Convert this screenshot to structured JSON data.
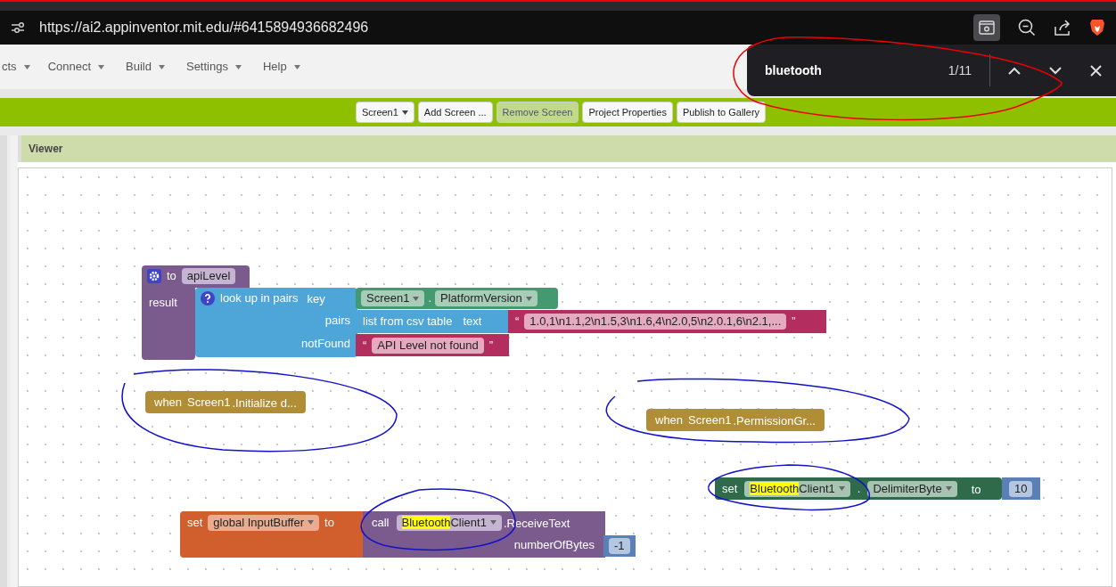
{
  "browser": {
    "url": "https://ai2.appinventor.mit.edu/#6415894936682496",
    "find_bar": {
      "query": "bluetooth",
      "count": "1/11"
    }
  },
  "menu": [
    "cts",
    "Connect",
    "Build",
    "Settings",
    "Help"
  ],
  "toolbar": [
    {
      "label": "Screen1",
      "dropdown": true,
      "disabled": false
    },
    {
      "label": "Add Screen ...",
      "dropdown": false,
      "disabled": false
    },
    {
      "label": "Remove Screen",
      "dropdown": false,
      "disabled": true
    },
    {
      "label": "Project Properties",
      "dropdown": false,
      "disabled": false
    },
    {
      "label": "Publish to Gallery",
      "dropdown": false,
      "disabled": false
    }
  ],
  "viewer": {
    "title": "Viewer",
    "procedure": {
      "to": "to",
      "name": "apiLevel",
      "result": "result",
      "lookup": "look up in pairs",
      "key": "key",
      "pairs": "pairs",
      "not_found": "notFound",
      "component": "Screen1",
      "dot": ".",
      "property": "PlatformVersion",
      "csv": "list from csv table",
      "text": "text",
      "open_quote": "“",
      "close_quote": "”",
      "csv_string": "1.0,1\\n1.1,2\\n1.5,3\\n1.6,4\\n2.0,5\\n2.0.1,6\\n2.1,...",
      "not_found_string": "API Level not found"
    },
    "events": [
      {
        "when": "when",
        "component": "Screen1",
        "event": ".Initialize d..."
      },
      {
        "when": "when",
        "component": "Screen1",
        "event": ".PermissionGr..."
      }
    ],
    "setter": {
      "set": "set",
      "match": "Bluetooth",
      "rest": "Client1",
      "dot": ".",
      "property": "DelimiterByte",
      "to": "to",
      "value": "10"
    },
    "global_set": {
      "set": "set",
      "variable": "global InputBuffer",
      "to": "to",
      "call": "call",
      "match": "Bluetooth",
      "rest": "Client1",
      "method": ".ReceiveText",
      "param": "numberOfBytes",
      "value": "-1"
    }
  }
}
